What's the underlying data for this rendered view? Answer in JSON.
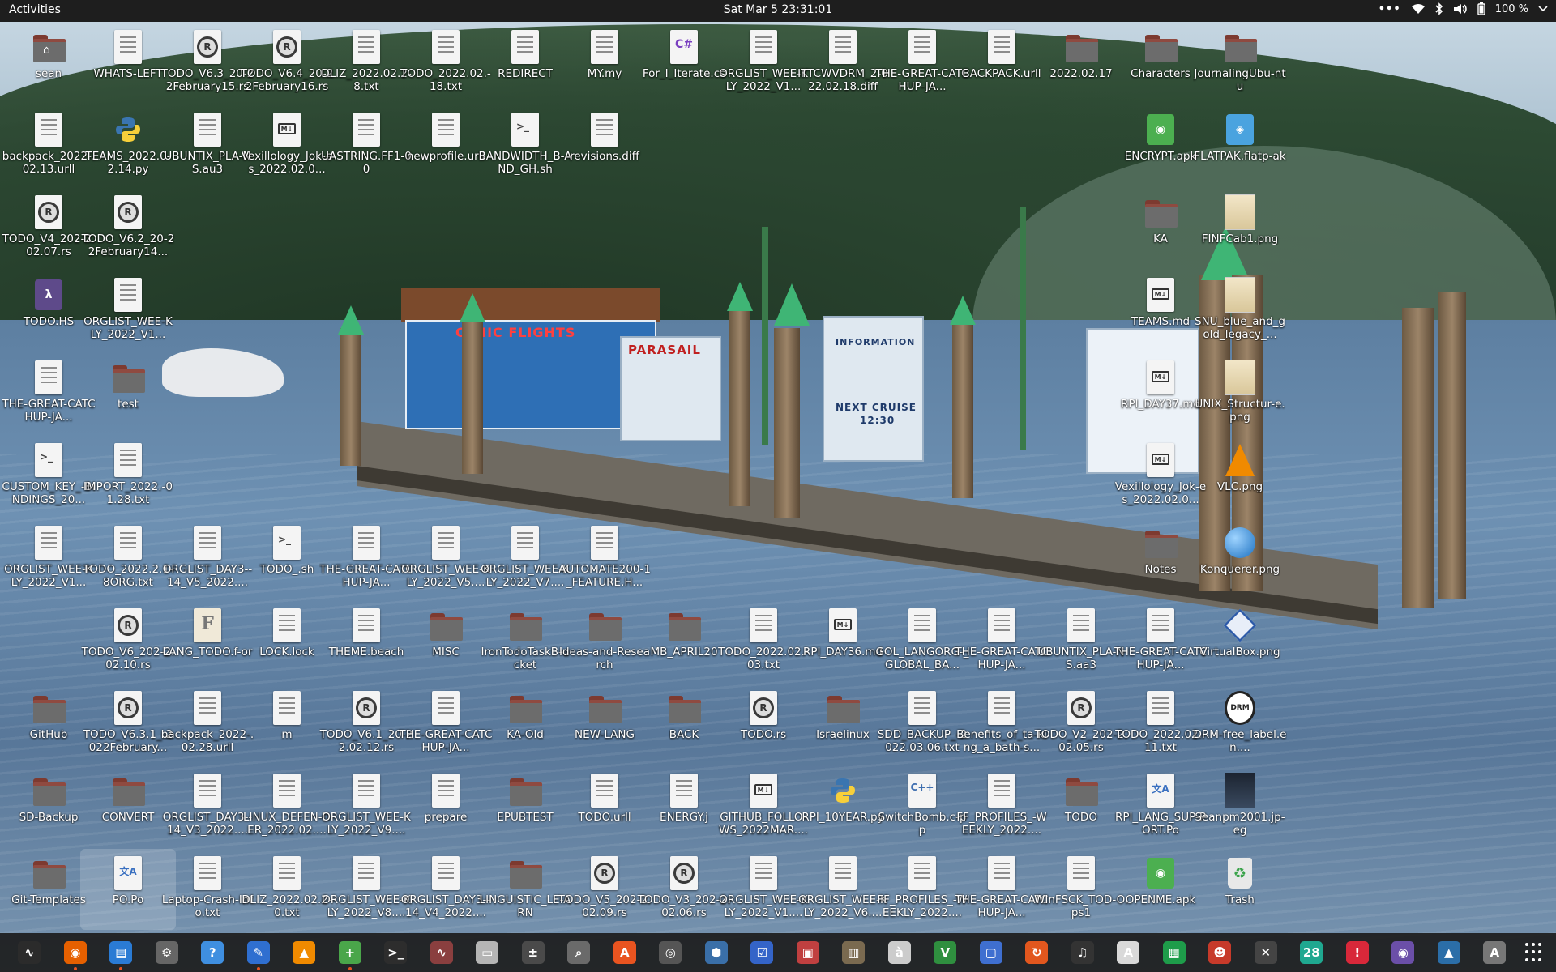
{
  "topbar": {
    "activities": "Activities",
    "clock": "Sat Mar 5  23:31:01",
    "battery": "100 %"
  },
  "wallpaper": {
    "signs": [
      "CENIC FLIGHTS",
      "PARASAIL",
      "INFORMATION",
      "NEXT CRUISE",
      "12:30"
    ]
  },
  "desktop": {
    "icons": [
      {
        "label": "sean",
        "type": "home-folder"
      },
      {
        "label": "WHATS-LEFT",
        "type": "text"
      },
      {
        "label": "TODO_V6.3_20-22February15.rs",
        "type": "rust"
      },
      {
        "label": "TODO_V6.4_20-22February16.rs",
        "type": "rust"
      },
      {
        "label": "DLIZ_2022.02.2-8.txt",
        "type": "text"
      },
      {
        "label": "TODO_2022.02.-18.txt",
        "type": "text"
      },
      {
        "label": "REDIRECT",
        "type": "text"
      },
      {
        "label": "MY.my",
        "type": "text"
      },
      {
        "label": "For_I_Iterate.cs",
        "type": "csharp"
      },
      {
        "label": "ORGLIST_WEE-KLY_2022_V1...",
        "type": "text"
      },
      {
        "label": "ITTCWVDRM_2-022.02.18.diff",
        "type": "text"
      },
      {
        "label": "THE-GREAT-CATCHUP-JA...",
        "type": "text"
      },
      {
        "label": "BACKPACK.urll",
        "type": "text"
      },
      {
        "label": "2022.02.17",
        "type": "folder"
      },
      {
        "label": "Characters",
        "type": "folder"
      },
      {
        "label": "JournalingUbu-ntu",
        "type": "folder"
      },
      {
        "label": "backpack_2022-.02.13.urll",
        "type": "text"
      },
      {
        "label": "TEAMS_2022.0-2.14.py",
        "type": "python"
      },
      {
        "label": "UBUNTIX_PLA-NS.au3",
        "type": "text"
      },
      {
        "label": "Vexillology_Jok-es_2022.02.0...",
        "type": "markdown"
      },
      {
        "label": "UASTRING.FF1-00",
        "type": "text"
      },
      {
        "label": "newprofile.urll",
        "type": "text"
      },
      {
        "label": "BANDWIDTH_B-AND_GH.sh",
        "type": "shell"
      },
      {
        "label": "revisions.diff",
        "type": "text"
      },
      {
        "label": "ENCRYPT.apk",
        "type": "apk"
      },
      {
        "label": "FLATPAK.flatp-ak",
        "type": "flatpak"
      },
      {
        "label": "TODO_V4_202-2.02.07.rs",
        "type": "rust"
      },
      {
        "label": "TODO_V6.2_20-22February14...",
        "type": "rust"
      },
      {
        "label": "KA",
        "type": "folder"
      },
      {
        "label": "FINFCab1.png",
        "type": "image"
      },
      {
        "label": "TODO.HS",
        "type": "haskell"
      },
      {
        "label": "ORGLIST_WEE-KLY_2022_V1...",
        "type": "text"
      },
      {
        "label": "TEAMS.md",
        "type": "markdown"
      },
      {
        "label": "SNU_blue_and_gold_legacy_...",
        "type": "image"
      },
      {
        "label": "THE-GREAT-CATCHUP-JA...",
        "type": "text"
      },
      {
        "label": "test",
        "type": "folder"
      },
      {
        "label": "RPI_DAY37.md",
        "type": "markdown"
      },
      {
        "label": "UNIX_Structur-e.png",
        "type": "image"
      },
      {
        "label": "CUSTOM_KEY_-BINDINGS_20...",
        "type": "shell"
      },
      {
        "label": "IMPORT_2022.-01.28.txt",
        "type": "text"
      },
      {
        "label": "Vexillology_Jok-es_2022.02.0...",
        "type": "markdown"
      },
      {
        "label": "VLC.png",
        "type": "vlc"
      },
      {
        "label": "ORGLIST_WEE-KLY_2022_V1...",
        "type": "text"
      },
      {
        "label": "TODO_2022.2.1-8ORG.txt",
        "type": "text"
      },
      {
        "label": "ORGLIST_DAY3--14_V5_2022....",
        "type": "text"
      },
      {
        "label": "TODO_.sh",
        "type": "shell"
      },
      {
        "label": "THE-GREAT-CATCHUP-JA...",
        "type": "text"
      },
      {
        "label": "ORGLIST_WEE-KLY_2022_V5....",
        "type": "text"
      },
      {
        "label": "ORGLIST_WEE-KLY_2022_V7....",
        "type": "text"
      },
      {
        "label": "AUTOMATE200-1_FEATURE.H...",
        "type": "text"
      },
      {
        "label": "Notes",
        "type": "folder"
      },
      {
        "label": "Konquerer.png",
        "type": "globe"
      },
      {
        "label": "TODO_V6_202-2.02.10.rs",
        "type": "rust"
      },
      {
        "label": "LANG_TODO.f-or",
        "type": "fortran"
      },
      {
        "label": "LOCK.lock",
        "type": "text"
      },
      {
        "label": "THEME.beach",
        "type": "text"
      },
      {
        "label": "MISC",
        "type": "folder"
      },
      {
        "label": "IronTodoTaskB-ucket",
        "type": "folder"
      },
      {
        "label": "Ideas-and-Research",
        "type": "folder"
      },
      {
        "label": "MB_APRIL20",
        "type": "folder"
      },
      {
        "label": "TODO_2022.02.-03.txt",
        "type": "text"
      },
      {
        "label": "RPI_DAY36.md",
        "type": "markdown"
      },
      {
        "label": "GOL_LANGORG-_GLOBAL_BA...",
        "type": "text"
      },
      {
        "label": "THE-GREAT-CATCHUP-JA...",
        "type": "text"
      },
      {
        "label": "UBUNTIX_PLA-NS.aa3",
        "type": "text"
      },
      {
        "label": "THE-GREAT-CATCHUP-JA...",
        "type": "text"
      },
      {
        "label": "VirtualBox.png",
        "type": "vbox"
      },
      {
        "label": "GitHub",
        "type": "folder"
      },
      {
        "label": "TODO_V6.3.1_-2022February...",
        "type": "rust"
      },
      {
        "label": "backpack_2022-.02.28.urll",
        "type": "text"
      },
      {
        "label": "m",
        "type": "text"
      },
      {
        "label": "TODO_V6.1_20-22.02.12.rs",
        "type": "rust"
      },
      {
        "label": "THE-GREAT-CATCHUP-JA...",
        "type": "text"
      },
      {
        "label": "KA-Old",
        "type": "folder"
      },
      {
        "label": "NEW-LANG",
        "type": "folder"
      },
      {
        "label": "BACK",
        "type": "folder"
      },
      {
        "label": "TODO.rs",
        "type": "rust"
      },
      {
        "label": "Israelinux",
        "type": "folder"
      },
      {
        "label": "SDD_BACKUP_-2022.03.06.txt",
        "type": "text"
      },
      {
        "label": "Benefits_of_ta-king_a_bath-s...",
        "type": "text"
      },
      {
        "label": "TODO_V2_202-2.02.05.rs",
        "type": "rust"
      },
      {
        "label": "TODO_2022.02.-11.txt",
        "type": "text"
      },
      {
        "label": "DRM-free_label.en....",
        "type": "drm"
      },
      {
        "label": "SD-Backup",
        "type": "folder"
      },
      {
        "label": "CONVERT",
        "type": "folder"
      },
      {
        "label": "ORGLIST_DAY3--14_V3_2022....",
        "type": "text"
      },
      {
        "label": "LINUX_DEFEN-DER_2022.02....",
        "type": "text"
      },
      {
        "label": "ORGLIST_WEE-KLY_2022_V9....",
        "type": "text"
      },
      {
        "label": "prepare",
        "type": "text"
      },
      {
        "label": "EPUBTEST",
        "type": "folder"
      },
      {
        "label": "TODO.urll",
        "type": "text"
      },
      {
        "label": "ENERGY.j",
        "type": "text"
      },
      {
        "label": "GITHUB_FOLLO-WS_2022MAR....",
        "type": "markdown"
      },
      {
        "label": "RPI_10YEAR.py",
        "type": "python"
      },
      {
        "label": "SwitchBomb.c-pp",
        "type": "cpp"
      },
      {
        "label": "FF_PROFILES_-WEEKLY_2022....",
        "type": "text"
      },
      {
        "label": "TODO",
        "type": "folder"
      },
      {
        "label": "RPI_LANG_SUP-PORT.Po",
        "type": "po"
      },
      {
        "label": "Seanpm2001.jp-eg",
        "type": "photo"
      },
      {
        "label": "Git-Templates",
        "type": "folder"
      },
      {
        "label": "PO.Po",
        "type": "po"
      },
      {
        "label": "Laptop-Crash-Info.txt",
        "type": "text"
      },
      {
        "label": "DLIZ_2022.02.2-0.txt",
        "type": "text"
      },
      {
        "label": "ORGLIST_WEE-KLY_2022_V8....",
        "type": "text"
      },
      {
        "label": "ORGLIST_DAY3--14_V4_2022....",
        "type": "text"
      },
      {
        "label": "LINGUISTIC_LE-ARN",
        "type": "folder"
      },
      {
        "label": "TODO_V5_202-2.02.09.rs",
        "type": "rust"
      },
      {
        "label": "TODO_V3_202-2.02.06.rs",
        "type": "rust"
      },
      {
        "label": "ORGLIST_WEE-KLY_2022_V1....",
        "type": "text"
      },
      {
        "label": "ORGLIST_WEE-KLY_2022_V6....",
        "type": "text"
      },
      {
        "label": "FF_PROFILES_-WEEKLY_2022....",
        "type": "text"
      },
      {
        "label": "THE-GREAT-CATCHUP-JA...",
        "type": "text"
      },
      {
        "label": "WInFSCK_TOD-O.ps1",
        "type": "text"
      },
      {
        "label": "OPENME.apk",
        "type": "apk"
      },
      {
        "label": "Trash",
        "type": "trash"
      }
    ]
  },
  "dock": {
    "apps": [
      {
        "name": "system-monitor-icon",
        "glyph": "∿",
        "bg": "#2b2b2b",
        "running": false
      },
      {
        "name": "firefox-icon",
        "glyph": "◉",
        "bg": "#e66000",
        "running": true
      },
      {
        "name": "document-viewer-icon",
        "glyph": "▤",
        "bg": "#2a7bd4",
        "running": true
      },
      {
        "name": "settings-icon",
        "glyph": "⚙",
        "bg": "#666666",
        "running": false
      },
      {
        "name": "help-icon",
        "glyph": "?",
        "bg": "#3f8fe0",
        "running": false
      },
      {
        "name": "text-editor-icon",
        "glyph": "✎",
        "bg": "#2f6fd0",
        "running": true
      },
      {
        "name": "vlc-icon",
        "glyph": "▲",
        "bg": "#f08a00",
        "running": false
      },
      {
        "name": "add-app-icon",
        "glyph": "+",
        "bg": "#4aa64a",
        "running": true
      },
      {
        "name": "terminal-icon",
        "glyph": ">_",
        "bg": "#2d2d2d",
        "running": false
      },
      {
        "name": "waveform-icon",
        "glyph": "∿",
        "bg": "#8a3f3f",
        "running": false
      },
      {
        "name": "files-icon",
        "glyph": "▭",
        "bg": "#b5b5b5",
        "running": false
      },
      {
        "name": "calculator-icon",
        "glyph": "±",
        "bg": "#4a4a4a",
        "running": false
      },
      {
        "name": "search-tool-icon",
        "glyph": "⌕",
        "bg": "#6a6a6a",
        "running": false
      },
      {
        "name": "app-store-icon",
        "glyph": "A",
        "bg": "#e95420",
        "running": false
      },
      {
        "name": "disc-icon",
        "glyph": "◎",
        "bg": "#555555",
        "running": false
      },
      {
        "name": "hex-editor-icon",
        "glyph": "⬢",
        "bg": "#3a6fa8",
        "running": false
      },
      {
        "name": "tasks-icon",
        "glyph": "☑",
        "bg": "#3464c8",
        "running": false
      },
      {
        "name": "screenshot-icon",
        "glyph": "▣",
        "bg": "#c04040",
        "running": false
      },
      {
        "name": "archive-icon",
        "glyph": "▥",
        "bg": "#7a6a50",
        "running": false
      },
      {
        "name": "characters-icon",
        "glyph": "à",
        "bg": "#cccccc",
        "running": false
      },
      {
        "name": "vim-icon",
        "glyph": "V",
        "bg": "#2f8f3f",
        "running": false
      },
      {
        "name": "screen-icon",
        "glyph": "▢",
        "bg": "#3f6fd0",
        "running": false
      },
      {
        "name": "update-icon",
        "glyph": "↻",
        "bg": "#e2571e",
        "running": false
      },
      {
        "name": "music-icon",
        "glyph": "♫",
        "bg": "#333333",
        "running": false
      },
      {
        "name": "font-viewer-icon",
        "glyph": "A",
        "bg": "#d9d9d9",
        "running": false
      },
      {
        "name": "spreadsheet-icon",
        "glyph": "▦",
        "bg": "#1e9c4a",
        "running": false
      },
      {
        "name": "game-icon",
        "glyph": "☻",
        "bg": "#c73a2a",
        "running": false
      },
      {
        "name": "tool-icon",
        "glyph": "✕",
        "bg": "#444444",
        "running": false
      },
      {
        "name": "calendar-icon",
        "glyph": "28",
        "bg": "#1fa890",
        "running": false
      },
      {
        "name": "alert-icon",
        "glyph": "!",
        "bg": "#d8283a",
        "running": false
      },
      {
        "name": "camera-icon",
        "glyph": "◉",
        "bg": "#6b4fa8",
        "running": false
      },
      {
        "name": "image-viewer-icon",
        "glyph": "▲",
        "bg": "#2b6ea8",
        "running": false
      },
      {
        "name": "app-icon",
        "glyph": "A",
        "bg": "#777777",
        "running": false
      }
    ]
  }
}
